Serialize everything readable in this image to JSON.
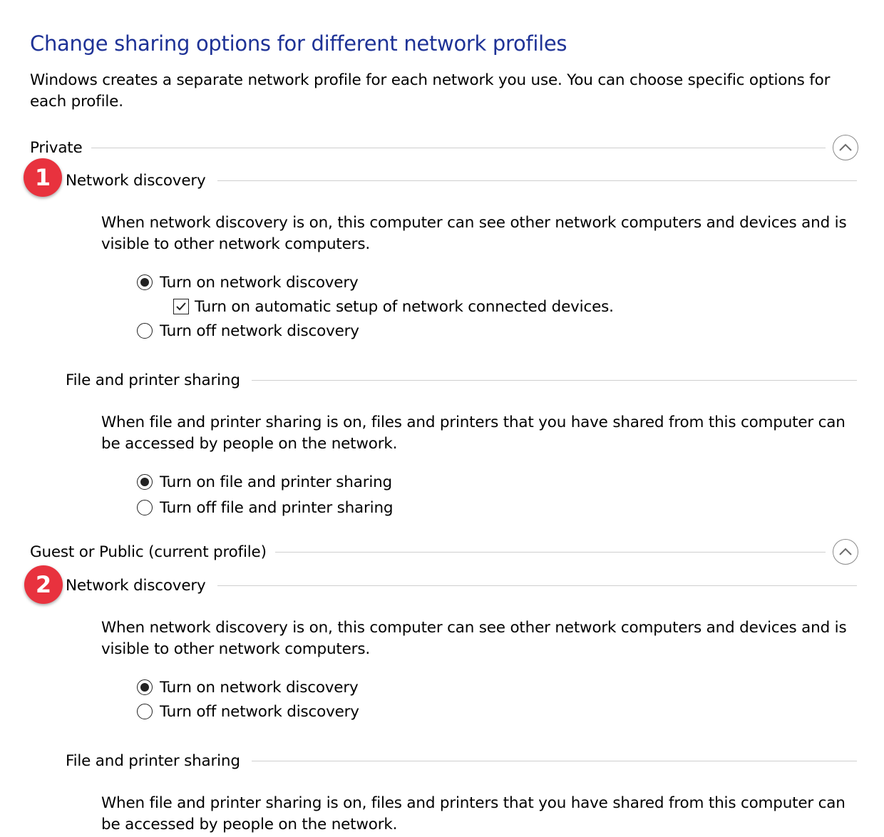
{
  "page": {
    "title": "Change sharing options for different network profiles",
    "intro": "Windows creates a separate network profile for each network you use. You can choose specific options for each profile."
  },
  "profiles": [
    {
      "label": "Private",
      "expanded": true,
      "marker": "1",
      "network_discovery": {
        "heading": "Network discovery",
        "description": "When network discovery is on, this computer can see other network computers and devices and is visible to other network computers.",
        "on_label": "Turn on network discovery",
        "auto_setup_label": "Turn on automatic setup of network connected devices.",
        "auto_setup_checked": true,
        "off_label": "Turn off network discovery",
        "selected": "on"
      },
      "file_sharing": {
        "heading": "File and printer sharing",
        "description": "When file and printer sharing is on, files and printers that you have shared from this computer can be accessed by people on the network.",
        "on_label": "Turn on file and printer sharing",
        "off_label": "Turn off file and printer sharing",
        "selected": "on"
      }
    },
    {
      "label": "Guest or Public (current profile)",
      "expanded": true,
      "marker": "2",
      "network_discovery": {
        "heading": "Network discovery",
        "description": "When network discovery is on, this computer can see other network computers and devices and is visible to other network computers.",
        "on_label": "Turn on network discovery",
        "off_label": "Turn off network discovery",
        "selected": "on"
      },
      "file_sharing": {
        "heading": "File and printer sharing",
        "description": "When file and printer sharing is on, files and printers that you have shared from this computer can be accessed by people on the network."
      }
    }
  ],
  "colors": {
    "title": "#1e3296",
    "marker": "#e8323e",
    "rule": "#cfcfcf"
  },
  "icons": {
    "collapse": "chevron-up-icon",
    "check": "checkmark-icon"
  }
}
